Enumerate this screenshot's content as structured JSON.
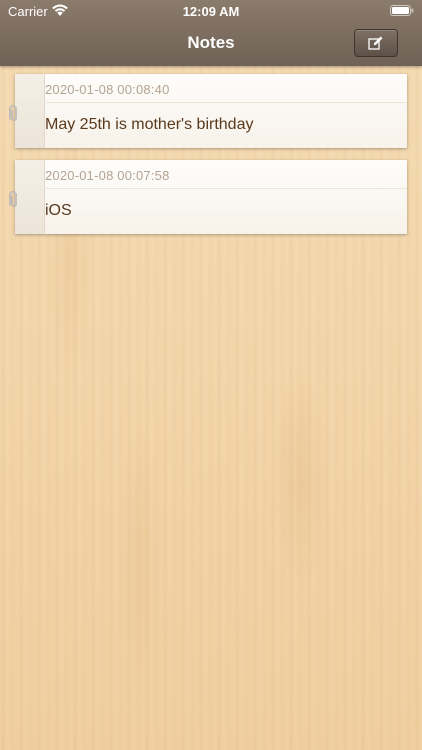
{
  "status_bar": {
    "carrier": "Carrier",
    "time": "12:09 AM",
    "wifi_icon": "wifi-icon",
    "battery_icon": "battery-icon"
  },
  "header": {
    "title": "Notes",
    "compose_icon": "compose-icon"
  },
  "notes": [
    {
      "date": "2020-01-08 00:08:40",
      "text": "May 25th is mother's birthday"
    },
    {
      "date": "2020-01-08 00:07:58",
      "text": "iOS"
    }
  ],
  "colors": {
    "header": "#7a6b5e",
    "background_wood": "#f3d6ab",
    "note_text": "#5a3a1f",
    "note_date": "#b3a493"
  }
}
